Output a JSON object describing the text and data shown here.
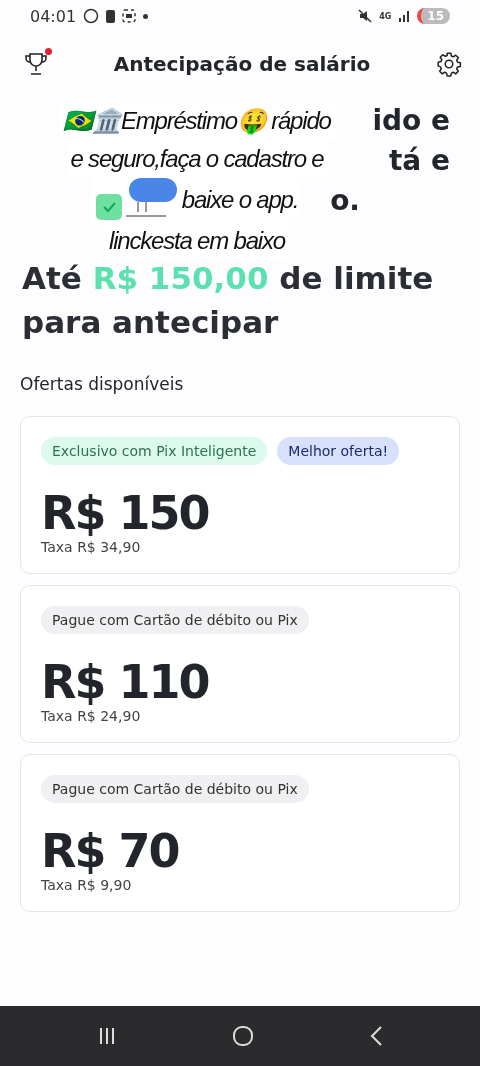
{
  "status_bar": {
    "time": "04:01",
    "network": "4G",
    "battery": "15"
  },
  "header": {
    "title": "Antecipação de salário",
    "trophy_badge": true
  },
  "intro_fragments": [
    "ido e",
    "tá e",
    "o."
  ],
  "overlay_caption": {
    "lines": [
      "🇧🇷🏛️Empréstimo🤑 rápido",
      "e seguro,faça o cadastro e",
      "baixe  o app.",
      "linckesta em baixo"
    ]
  },
  "headline": {
    "before": "Até",
    "amount": "R$ 150,00",
    "after": "de limite para antecipar"
  },
  "section_title": "Ofertas disponíveis",
  "offers": [
    {
      "tags": [
        {
          "label": "Exclusivo com Pix Inteligente",
          "kind": "green"
        },
        {
          "label": "Melhor oferta!",
          "kind": "blue"
        }
      ],
      "amount": "R$ 150",
      "fee": "Taxa R$ 34,90"
    },
    {
      "tags": [
        {
          "label": "Pague com Cartão de débito ou Pix",
          "kind": "grey"
        }
      ],
      "amount": "R$ 110",
      "fee": "Taxa R$ 24,90"
    },
    {
      "tags": [
        {
          "label": "Pague com Cartão de débito ou Pix",
          "kind": "grey"
        }
      ],
      "amount": "R$ 70",
      "fee": "Taxa R$ 9,90"
    }
  ]
}
